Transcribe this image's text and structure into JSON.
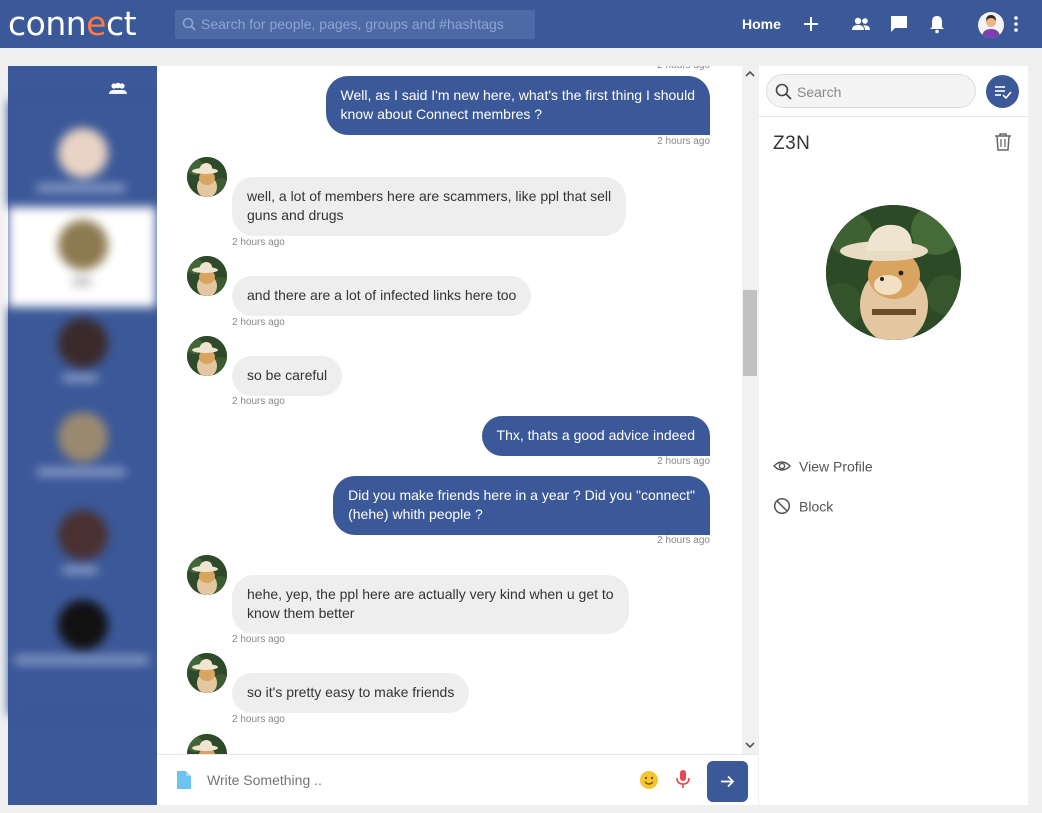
{
  "topbar": {
    "logo": {
      "pre": "conn",
      "accent": "e",
      "post": "ct"
    },
    "search_placeholder": "Search for people, pages, groups and #hashtags",
    "home_label": "Home"
  },
  "chat": {
    "messages": [
      {
        "dir": "out",
        "text_lines": [
          "Well, as I said I'm new here, what's the first thing I should",
          "know about Connect membres ?"
        ],
        "time": "2 hours ago"
      },
      {
        "dir": "in",
        "text_lines": [
          "well, a lot of members here are scammers, like ppl that sell",
          "guns and drugs"
        ],
        "time": "2 hours ago"
      },
      {
        "dir": "in",
        "text_lines": [
          "and there are a lot of infected links here too"
        ],
        "time": "2 hours ago"
      },
      {
        "dir": "in",
        "text_lines": [
          "so be careful"
        ],
        "time": "2 hours ago"
      },
      {
        "dir": "out",
        "text_lines": [
          "Thx, thats a good advice indeed"
        ],
        "time": "2 hours ago"
      },
      {
        "dir": "out",
        "text_lines": [
          "Did you make friends here in a year ? Did you \"connect\"",
          "(hehe) whith people ?"
        ],
        "time": "2 hours ago"
      },
      {
        "dir": "in",
        "text_lines": [
          "hehe, yep, the ppl here are actually very kind when u get to",
          "know them better"
        ],
        "time": "2 hours ago"
      },
      {
        "dir": "in",
        "text_lines": [
          "so it's pretty easy to make friends"
        ],
        "time": "2 hours ago"
      }
    ]
  },
  "composer": {
    "placeholder": "Write Something .."
  },
  "right_panel": {
    "search_placeholder": "Search",
    "contact_name": "Z3N",
    "actions": {
      "view_profile": "View Profile",
      "block": "Block"
    }
  },
  "colors": {
    "brand": "#3b5898",
    "accent": "#ff7a45",
    "bubble_in": "#eeeeee"
  }
}
